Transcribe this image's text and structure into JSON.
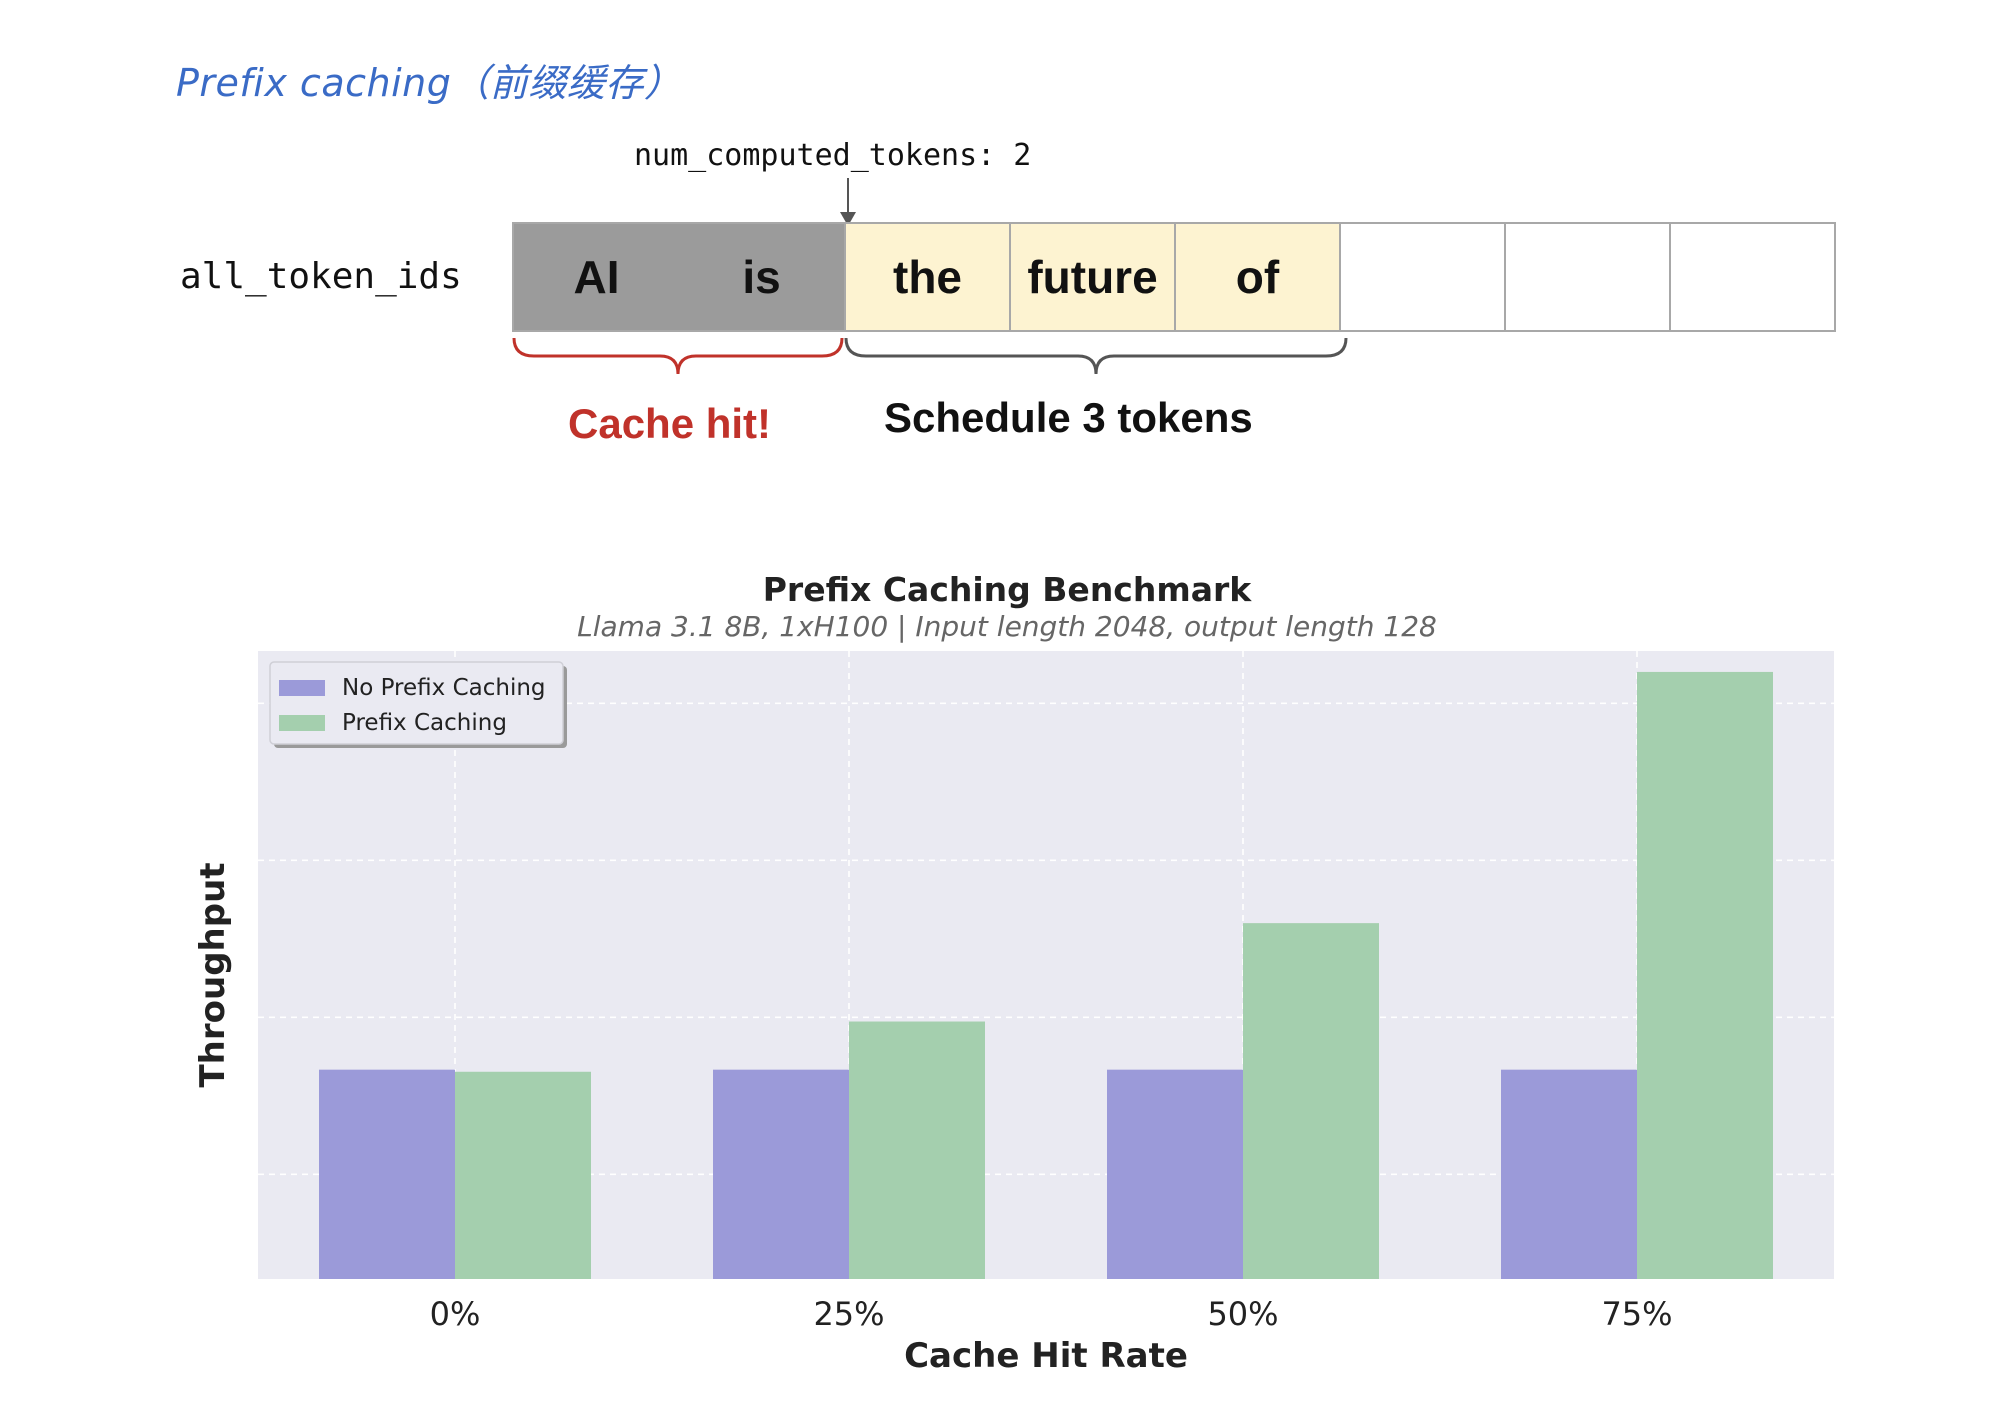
{
  "heading": "Prefix caching（前缀缓存）",
  "diagram": {
    "computed_label": "num_computed_tokens: 2",
    "row_label": "all_token_ids",
    "tokens": [
      {
        "text": "AI",
        "state": "cached"
      },
      {
        "text": "is",
        "state": "cached"
      },
      {
        "text": "the",
        "state": "scheduled"
      },
      {
        "text": "future",
        "state": "scheduled"
      },
      {
        "text": "of",
        "state": "scheduled"
      },
      {
        "text": "",
        "state": "empty"
      },
      {
        "text": "",
        "state": "empty"
      },
      {
        "text": "",
        "state": "empty"
      }
    ],
    "cache_hit_label": "Cache hit!",
    "schedule_label": "Schedule 3 tokens",
    "colors": {
      "cached": "#9b9b9b",
      "scheduled": "#fdf3d1",
      "cache_hit": "#c0322a",
      "brace_schedule": "#555555"
    }
  },
  "chart_data": {
    "type": "bar",
    "title": "Prefix Caching Benchmark",
    "subtitle": "Llama 3.1 8B, 1xH100 | Input length 2048, output length 128",
    "xlabel": "Cache Hit Rate",
    "ylabel": "Throughput",
    "categories": [
      "0%",
      "25%",
      "50%",
      "75%"
    ],
    "series": [
      {
        "name": "No Prefix Caching",
        "color": "#9b9ad9",
        "values": [
          1.0,
          1.0,
          1.0,
          1.0
        ]
      },
      {
        "name": "Prefix Caching",
        "color": "#a4cfae",
        "values": [
          0.99,
          1.23,
          1.7,
          2.9
        ]
      }
    ],
    "ylim": [
      0,
      3.0
    ],
    "grid": true,
    "legend": "top-left",
    "y_tick_labels_shown": false
  }
}
